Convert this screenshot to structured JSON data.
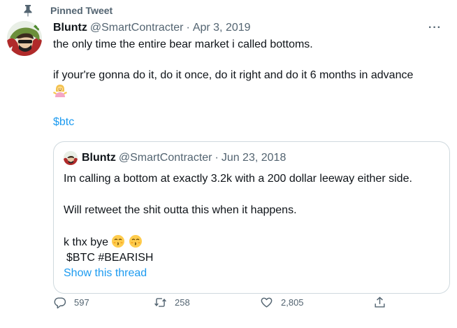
{
  "pinned_label": "Pinned Tweet",
  "tweet": {
    "name": "Bluntz",
    "handle": "@SmartContracter",
    "separator": "·",
    "date": "Apr 3, 2019",
    "more": "···",
    "line1": "the only time the entire bear market i called bottoms.",
    "line2": "if your're gonna do it, do it once, do it right and do it 6 months in advance",
    "line2_emoji": "woman-shrugging-emoji",
    "cashtag": "$btc"
  },
  "quote": {
    "name": "Bluntz",
    "handle": "@SmartContracter",
    "separator": "·",
    "date": "Jun 23, 2018",
    "line1": "Im calling a bottom at exactly 3.2k with a 200 dollar leeway either side.",
    "line2": "Will retweet the shit outta this when it happens.",
    "line3": "k thx bye",
    "line3_emojis": [
      "kissing-face-emoji",
      "kissing-face-emoji"
    ],
    "line4": "$BTC #BEARISH",
    "show_thread": "Show this thread"
  },
  "actions": {
    "replies": "597",
    "retweets": "258",
    "likes": "2,805"
  },
  "colors": {
    "link": "#1d9bf0",
    "secondary": "#536471",
    "border": "#cfd9de"
  }
}
